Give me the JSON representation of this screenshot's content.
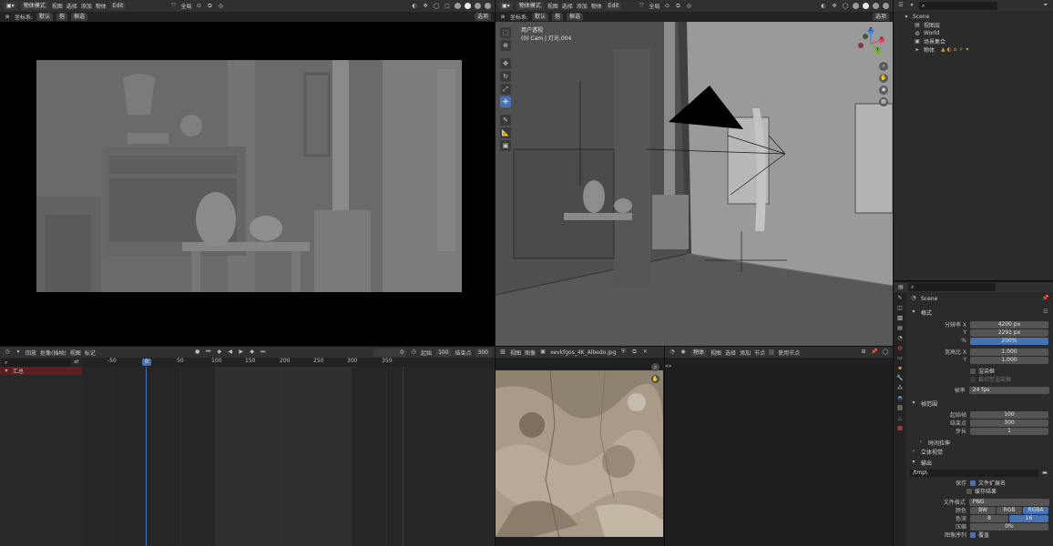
{
  "left_viewport": {
    "header": {
      "mode": "物体模式",
      "view": "视图",
      "select": "选择",
      "add": "添加",
      "object": "物体",
      "edit_badge": "Edit",
      "transform": "全局"
    },
    "subheader": {
      "coords_label": "坐标系:",
      "coords_value": "默认",
      "drag_value": "拖",
      "select_label": "框选",
      "options": "选项"
    }
  },
  "right_viewport": {
    "header": {
      "mode": "物体模式",
      "view": "视图",
      "select": "选择",
      "add": "添加",
      "object": "物体",
      "edit_badge": "Edit",
      "transform": "全局"
    },
    "subheader": {
      "coords_label": "坐标系:",
      "coords_value": "默认",
      "drag_value": "拖",
      "select_label": "框选",
      "options": "选项"
    },
    "overlay_title": "用户透视",
    "overlay_sub": "(0) Cam | 灯光.004",
    "gizmo": {
      "x": "X",
      "y": "Y",
      "z": "Z"
    }
  },
  "outliner": {
    "search_placeholder": "",
    "items": [
      {
        "label": "Scene",
        "indent": 0
      },
      {
        "label": "视图层",
        "indent": 1
      },
      {
        "label": "World",
        "indent": 1
      },
      {
        "label": "场景集合",
        "indent": 1
      },
      {
        "label": "物体",
        "indent": 1
      }
    ]
  },
  "timeline": {
    "header": {
      "playback": "回放",
      "keying": "抠像(插帧)",
      "view": "视图",
      "marker": "标记",
      "current_frame": "0",
      "start_label": "起始",
      "start": "100",
      "end_label": "结束点",
      "end": "300"
    },
    "channel": "汇总",
    "ticks": [
      "-50",
      "0",
      "50",
      "100",
      "150",
      "200",
      "250",
      "300",
      "350"
    ],
    "current_tick": "0"
  },
  "image_editor": {
    "header": {
      "view": "视图",
      "image": "图像",
      "filename": "xevkfgos_4K_Albedo.jpg"
    }
  },
  "node_editor": {
    "header": {
      "mode": "物体",
      "view": "视图",
      "select": "选择",
      "add": "添加",
      "node": "节点",
      "use_nodes": "使用节点"
    }
  },
  "properties": {
    "scene_name": "Scene",
    "format_section": "格式",
    "resolution_x_label": "分辨率 X",
    "resolution_x": "4200 px",
    "resolution_y_label": "Y",
    "resolution_y": "2291 px",
    "percent_label": "%",
    "percent": "200%",
    "aspect_x_label": "宽高比 X",
    "aspect_x": "1.000",
    "aspect_y_label": "Y",
    "aspect_y": "1.000",
    "render_region": "渲染框",
    "crop": "裁切至渲染框",
    "fps_label": "帧率",
    "fps": "24 fps",
    "frame_range_section": "帧范围",
    "start_label": "起始帧",
    "start": "100",
    "end_label": "结束点",
    "end": "300",
    "step_label": "步长",
    "step": "1",
    "time_stretch": "时间拉伸",
    "stereo": "立体视觉",
    "output_section": "输出",
    "path": "/tmp\\",
    "save_label": "保存",
    "file_ext": "文件扩展名",
    "cache": "缓存结果",
    "file_format_label": "文件格式",
    "file_format": "PNG",
    "color_label": "颜色",
    "bw": "BW",
    "rgb": "RGB",
    "rgba": "RGBA",
    "depth_label": "色深",
    "depth_8": "8",
    "depth_16": "16",
    "compression_label": "压缩",
    "compression": "0%",
    "bottom_label": "图像序列",
    "bottom_value": "覆盖"
  },
  "colors": {
    "accent": "#4772b3",
    "timeline_cursor": "#4772b3",
    "channel_red": "#5c1e1e"
  }
}
